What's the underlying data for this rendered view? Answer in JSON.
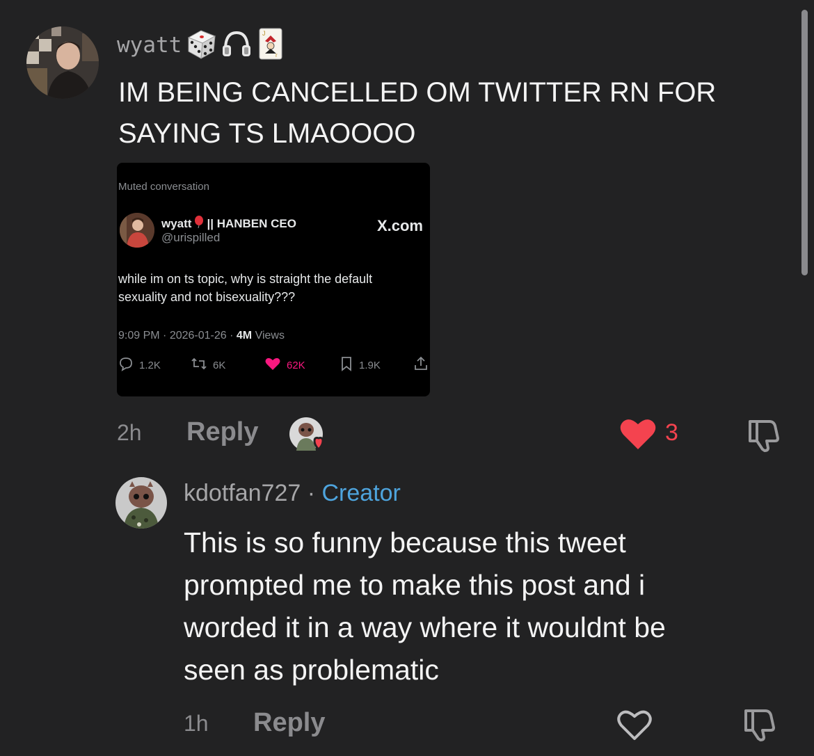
{
  "comment1": {
    "username": "wyatt",
    "username_emojis": [
      "dice-icon",
      "headphones-icon",
      "joker-card-icon"
    ],
    "text_lines": [
      "IM BEING CANCELLED OM TWITTER RN FOR",
      "SAYING TS LMAOOOO"
    ],
    "time": "2h",
    "reply_label": "Reply",
    "like_count": "3",
    "liked": true,
    "tweet": {
      "muted_label": "Muted conversation",
      "name": "wyatt",
      "name_suffix": "|| HANBEN CEO",
      "handle": "@urispilled",
      "source": "X.com",
      "body": "while im on ts topic, why is straight the default sexuality and not bisexuality???",
      "time": "9:09 PM",
      "date": "2026-01-26",
      "views_count": "4M",
      "views_label": "Views",
      "replies": "1.2K",
      "reposts": "6K",
      "likes": "62K",
      "bookmarks": "1.9K"
    }
  },
  "comment2": {
    "username": "kdotfan727",
    "separator": "·",
    "badge": "Creator",
    "text_lines": [
      "This is so funny because this tweet",
      "prompted me to make this post and i",
      "worded it in a way where it wouldnt be",
      "seen as problematic"
    ],
    "time": "1h",
    "reply_label": "Reply"
  },
  "colors": {
    "background": "#222223",
    "like_red": "#f4434f",
    "creator_blue": "#4ea4dd",
    "muted_gray": "#8b8b8e",
    "tweet_like_pink": "#f91880"
  }
}
